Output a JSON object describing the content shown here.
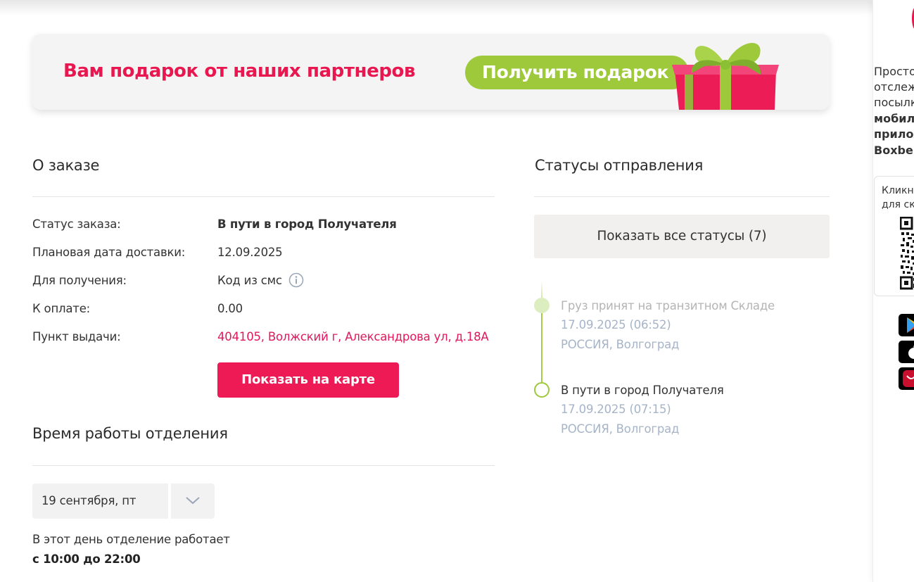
{
  "banner": {
    "title": "Вам подарок от наших партнеров",
    "button_label": "Получить подарок"
  },
  "order": {
    "heading": "О заказе",
    "rows": [
      {
        "label": "Статус заказа:",
        "value": "В пути в город Получателя"
      },
      {
        "label": "Плановая дата доставки:",
        "value": "12.09.2025"
      },
      {
        "label": "Для получения:",
        "value": "Код из смс"
      },
      {
        "label": "К оплате:",
        "value": "0.00"
      },
      {
        "label": "Пункт выдачи:",
        "value": "404105, Волжский г, Александрова ул, д.18А"
      }
    ],
    "map_button": "Показать на карте"
  },
  "hours": {
    "heading": "Время работы отделения",
    "selected_date": "19 сентября, пт",
    "note": "В этот день отделение работает",
    "value": "с 10:00 до 22:00"
  },
  "statuses": {
    "heading": "Статусы отправления",
    "show_all": "Показать все статусы (7)",
    "events": [
      {
        "title": "Груз принят на транзитном Складе",
        "date": "17.09.2025 (06:52)",
        "place": "РОССИЯ, Волгоград"
      },
      {
        "title": "В пути в город Получателя",
        "date": "17.09.2025 (07:15)",
        "place": "РОССИЯ, Волгоград"
      }
    ]
  },
  "sidebar": {
    "lines": [
      "Просто",
      "отслеж",
      "посылк"
    ],
    "bold_lines": [
      "мобил",
      "прилож",
      "Boxber"
    ],
    "card_lines": [
      "Кликни",
      "для ска"
    ],
    "store_icons": [
      "google-play-icon",
      "app-store-icon",
      "huawei-appgallery-icon"
    ]
  },
  "colors": {
    "brand": "#e8174f",
    "accent_green": "#9dc93b",
    "muted_blue": "#a6b4c8"
  }
}
